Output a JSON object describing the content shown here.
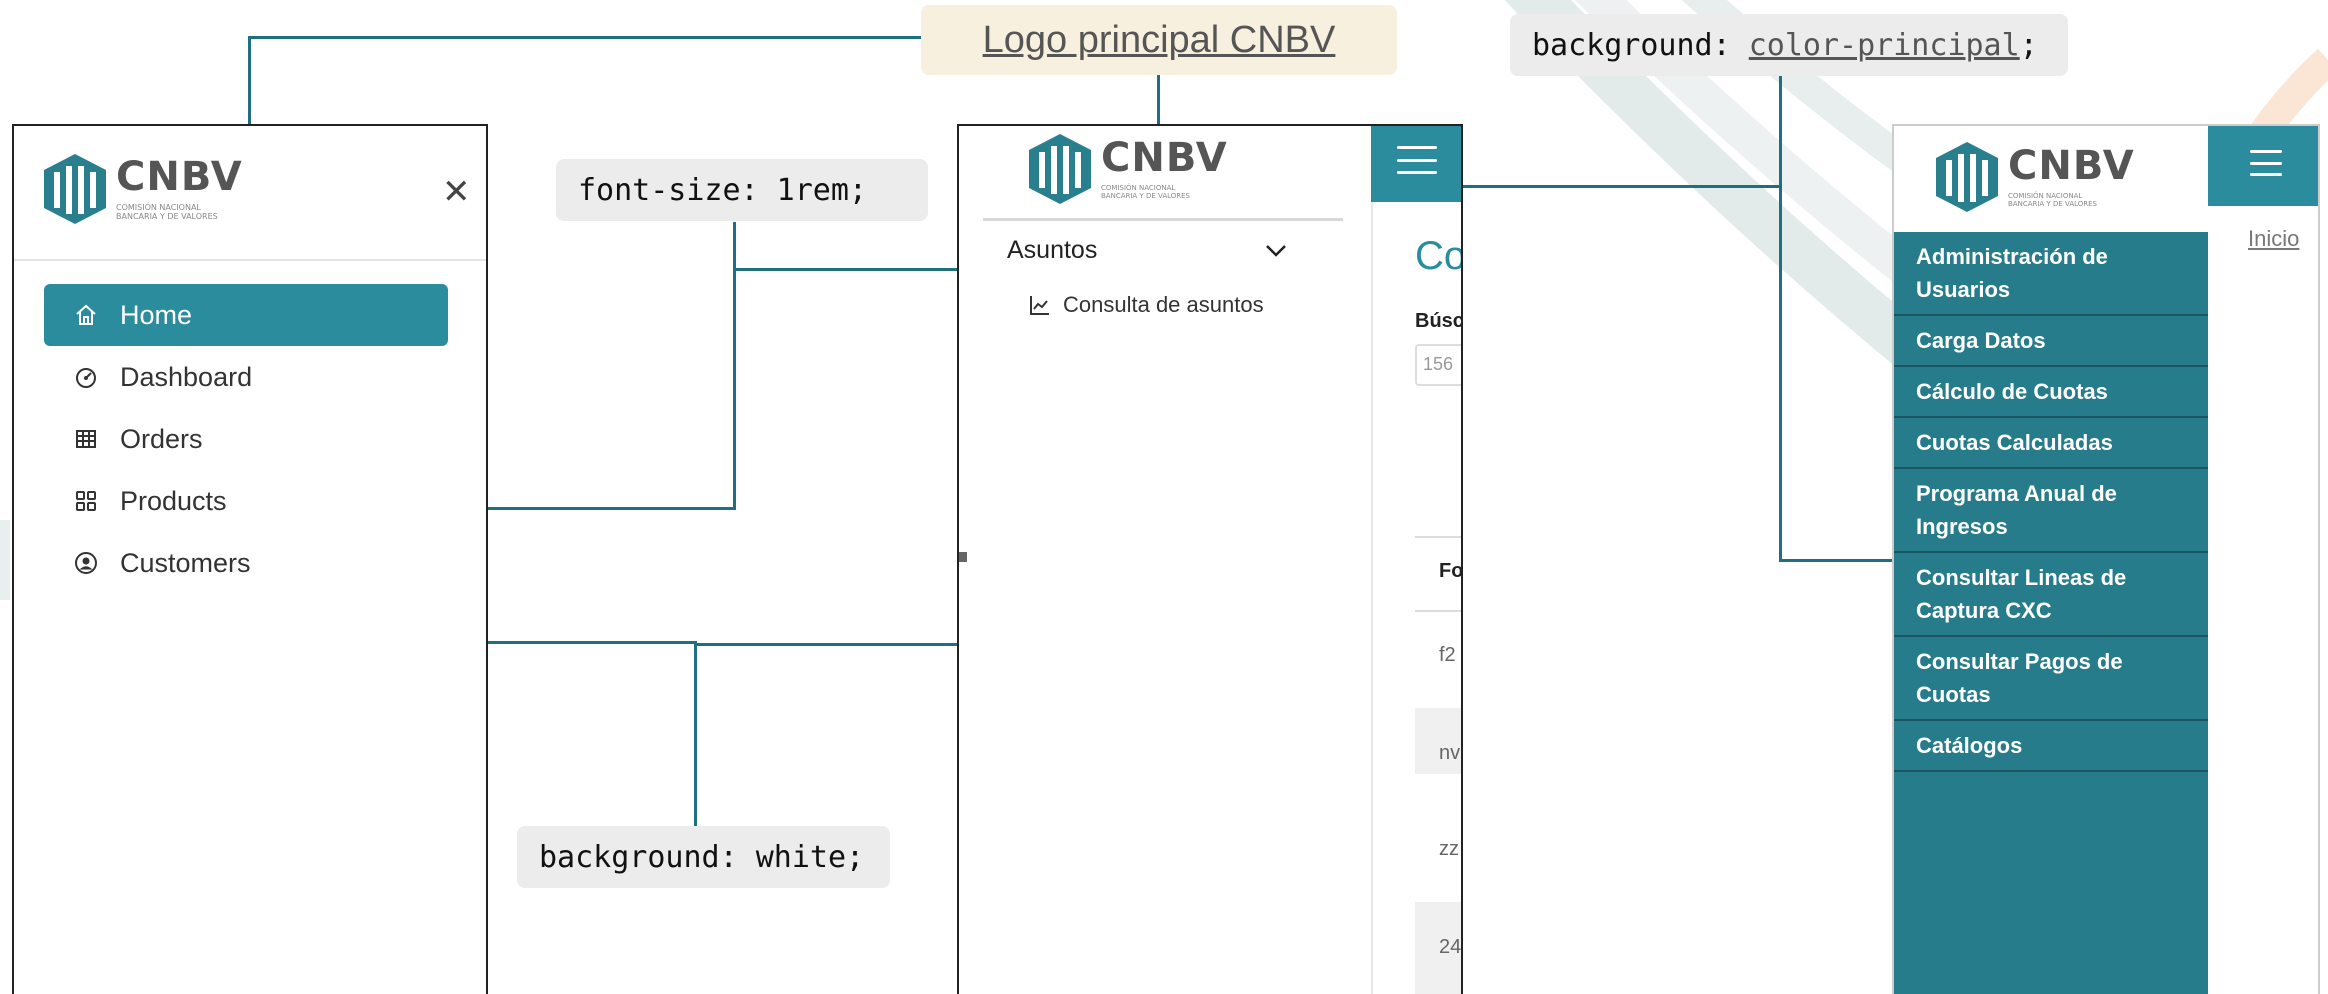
{
  "annotations": {
    "logo_principal": "Logo principal CNBV",
    "font_size": "font-size: 1rem;",
    "background_white": "background: white;",
    "background_prefix": "background: ",
    "background_value": "color-principal",
    "background_suffix": ";"
  },
  "logo": {
    "brand": "CNBV",
    "subtitle_line1": "COMISIÓN NACIONAL",
    "subtitle_line2": "BANCARIA Y DE VALORES"
  },
  "panel1": {
    "close_icon": "close-icon",
    "nav": [
      {
        "label": "Home",
        "icon": "home-icon",
        "active": true
      },
      {
        "label": "Dashboard",
        "icon": "dashboard-icon",
        "active": false
      },
      {
        "label": "Orders",
        "icon": "table-icon",
        "active": false
      },
      {
        "label": "Products",
        "icon": "grid-icon",
        "active": false
      },
      {
        "label": "Customers",
        "icon": "user-circle-icon",
        "active": false
      }
    ]
  },
  "panel2": {
    "accordion_label": "Asuntos",
    "submenu_label": "Consulta de asuntos",
    "main_peek": {
      "title": "Co",
      "search_label": "Búsc",
      "input_value": "156",
      "column_header": "Fo",
      "rows": [
        "f2",
        "nv",
        "zz",
        "24"
      ]
    }
  },
  "panel3": {
    "breadcrumb": "Inicio",
    "menu": [
      "Administración de Usuarios",
      "Carga Datos",
      "Cálculo de Cuotas",
      "Cuotas Calculadas",
      "Programa Anual de Ingresos",
      "Consultar Lineas de Captura CXC",
      "Consultar Pagos de Cuotas",
      "Catálogos"
    ]
  },
  "colors": {
    "primary": "#2a8c9c",
    "sidebar": "#267c8a",
    "connector": "#1f6f80"
  }
}
